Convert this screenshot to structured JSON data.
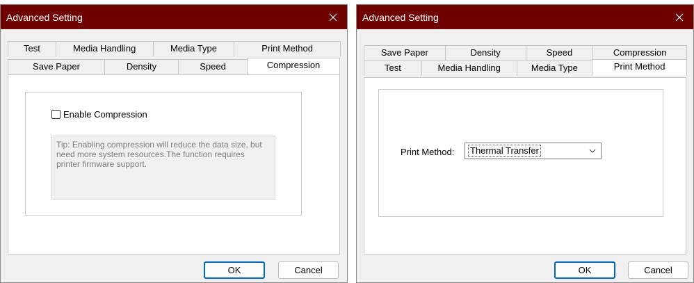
{
  "left_dialog": {
    "title": "Advanced Setting",
    "tabs_row1": [
      "Test",
      "Media Handling",
      "Media Type",
      "Print Method"
    ],
    "tabs_row2": [
      "Save Paper",
      "Density",
      "Speed",
      "Compression"
    ],
    "selected_tab": "Compression",
    "enable_compression_label": "Enable Compression",
    "enable_compression_checked": false,
    "tip_text": "Tip: Enabling compression will reduce the data size, but need more system resources.The function requires printer firmware support.",
    "ok_label": "OK",
    "cancel_label": "Cancel"
  },
  "right_dialog": {
    "title": "Advanced Setting",
    "tabs_row1": [
      "Save Paper",
      "Density",
      "Speed",
      "Compression"
    ],
    "tabs_row2": [
      "Test",
      "Media Handling",
      "Media Type",
      "Print Method"
    ],
    "selected_tab": "Print Method",
    "print_method_label": "Print Method:",
    "print_method_value": "Thermal Transfer",
    "ok_label": "OK",
    "cancel_label": "Cancel"
  },
  "icons": {
    "close": "close-icon",
    "dropdown": "chevron-down-icon"
  },
  "colors": {
    "titlebar": "#6e0000",
    "dialog_bg": "#f0f0f0",
    "default_button_border": "#0067c0",
    "tip_text": "#7d7d7d"
  }
}
